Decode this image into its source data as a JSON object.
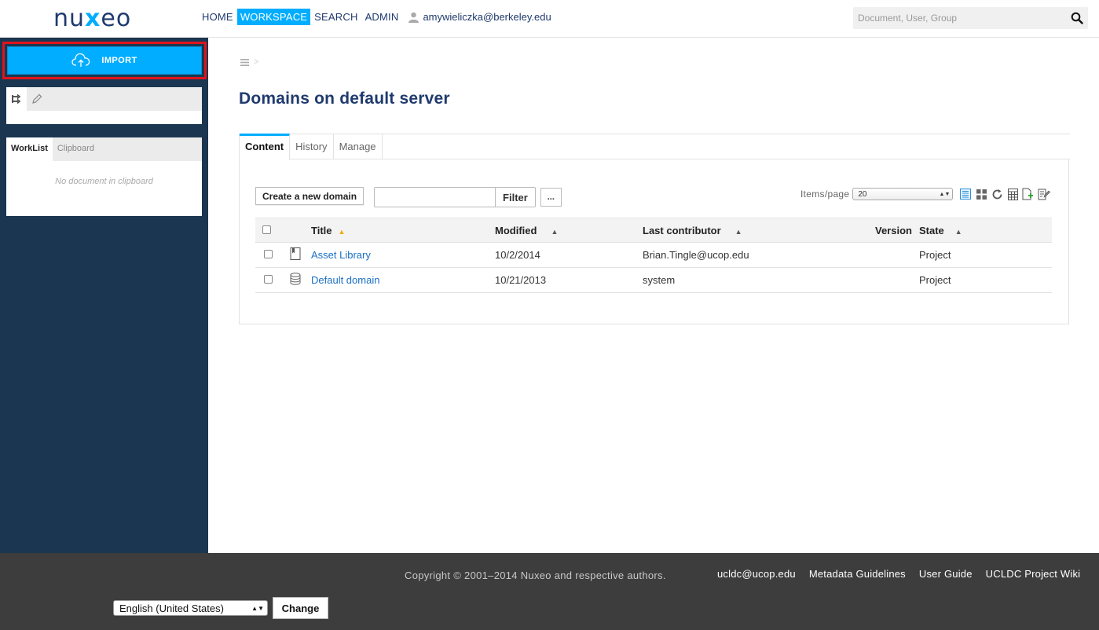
{
  "header": {
    "logo_left": "nu",
    "logo_x": "x",
    "logo_right": "eo",
    "nav": [
      {
        "label": "HOME",
        "active": false
      },
      {
        "label": "WORKSPACE",
        "active": true
      },
      {
        "label": "SEARCH",
        "active": false
      },
      {
        "label": "ADMIN",
        "active": false
      }
    ],
    "user_email": "amywieliczka@berkeley.edu",
    "search_placeholder": "Document, User, Group"
  },
  "sidebar": {
    "import_label": "IMPORT",
    "tree_tabs": [
      "tree-icon",
      "pencil-icon"
    ],
    "clipboard_tabs": [
      {
        "label": "WorkList",
        "active": true
      },
      {
        "label": "Clipboard",
        "active": false
      }
    ],
    "clipboard_empty": "No document in clipboard"
  },
  "main": {
    "breadcrumb_sep": ">",
    "title": "Domains on default server",
    "tabs": [
      {
        "label": "Content",
        "active": true
      },
      {
        "label": "History",
        "active": false
      },
      {
        "label": "Manage",
        "active": false
      }
    ],
    "create_button": "Create a new domain",
    "filter_value": "",
    "filter_button": "Filter",
    "more_button": "...",
    "items_per_page_label": "Items/page",
    "items_per_page_value": "20",
    "columns": [
      "Title",
      "Modified",
      "Last contributor",
      "Version",
      "State"
    ],
    "rows": [
      {
        "title": "Asset Library",
        "modified": "10/2/2014",
        "contributor": "Brian.Tingle@ucop.edu",
        "version": "",
        "state": "Project",
        "icon": "book-icon"
      },
      {
        "title": "Default domain",
        "modified": "10/21/2013",
        "contributor": "system",
        "version": "",
        "state": "Project",
        "icon": "database-icon"
      }
    ]
  },
  "footer": {
    "copyright": "Copyright © 2001–2014 Nuxeo and respective authors.",
    "links": [
      "ucldc@ucop.edu",
      "Metadata Guidelines",
      "User Guide",
      "UCLDC Project Wiki"
    ],
    "language": "English (United States)",
    "change_button": "Change"
  },
  "colors": {
    "accent": "#00adff",
    "sidebar_bg": "#1b3650",
    "title": "#1f3a6e",
    "footer_bg": "#3d3d3d",
    "highlight_border": "#e0141c"
  }
}
